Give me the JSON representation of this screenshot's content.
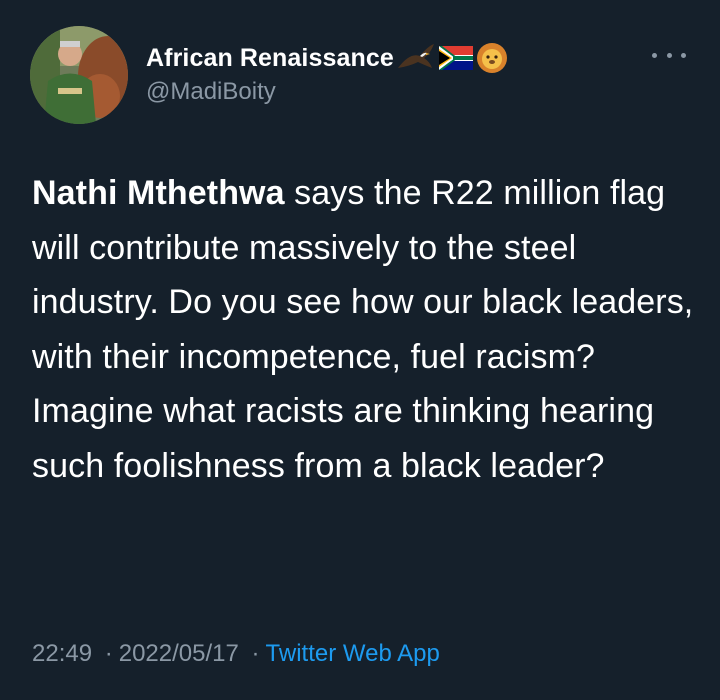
{
  "tweet": {
    "author": {
      "display_name": "African Renaissance",
      "name_emojis": [
        "eagle-emoji",
        "south-africa-flag-emoji",
        "lion-emoji"
      ],
      "handle": "@MadiBoity",
      "avatar": "profile-photo"
    },
    "more_icon": "more-horizontal-icon",
    "body": {
      "bold_name": "Nathi Mthethwa",
      "text": " says the R22 million flag will contribute massively to the steel industry. Do you see how our black leaders, with their incompetence, fuel racism? Imagine what racists are thinking hearing such foolishness from a black leader?"
    },
    "meta": {
      "time": "22:49",
      "separator": "·",
      "date": "2022/05/17",
      "source": "Twitter Web App"
    }
  },
  "colors": {
    "background": "#15202b",
    "text_primary": "#ffffff",
    "text_secondary": "#8b98a5",
    "link": "#1d9bf0"
  }
}
